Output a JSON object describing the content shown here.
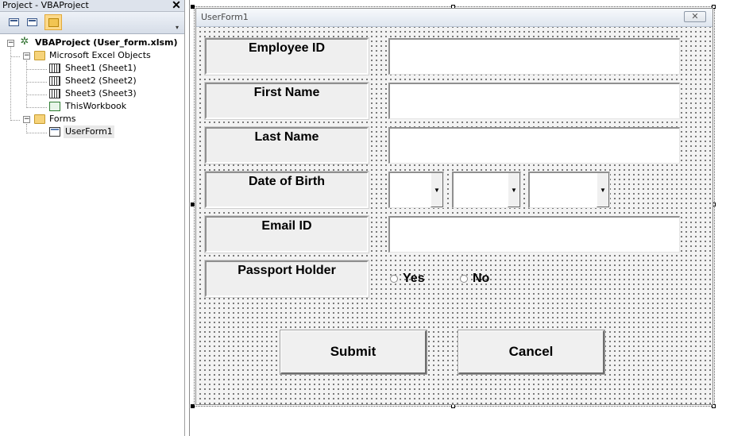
{
  "project_explorer": {
    "title": "Project - VBAProject",
    "close_glyph": "✕",
    "toolbar": [
      {
        "name": "view-code-icon"
      },
      {
        "name": "view-object-icon"
      },
      {
        "name": "toggle-folders-icon"
      }
    ],
    "tree": {
      "root": "VBAProject (User_form.xlsm)",
      "excel_objects_folder": "Microsoft Excel Objects",
      "sheets": [
        "Sheet1 (Sheet1)",
        "Sheet2 (Sheet2)",
        "Sheet3 (Sheet3)"
      ],
      "workbook": "ThisWorkbook",
      "forms_folder": "Forms",
      "forms": [
        "UserForm1"
      ]
    }
  },
  "userform": {
    "title": "UserForm1",
    "close_glyph": "✕",
    "labels": {
      "employee_id": "Employee ID",
      "first_name": "First Name",
      "last_name": "Last Name",
      "date_of_birth": "Date of Birth",
      "email_id": "Email ID",
      "passport_holder": "Passport Holder"
    },
    "fields": {
      "employee_id": "",
      "first_name": "",
      "last_name": "",
      "email_id": ""
    },
    "dob_combos": [
      "",
      "",
      ""
    ],
    "radio_options": [
      "Yes",
      "No"
    ],
    "buttons": {
      "submit": "Submit",
      "cancel": "Cancel"
    }
  }
}
